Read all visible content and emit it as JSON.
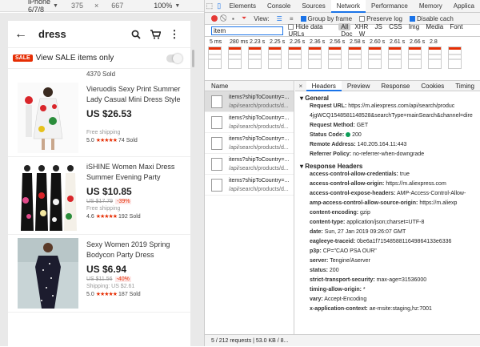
{
  "device_bar": {
    "device": "iPhone 6/7/8",
    "width": "375",
    "x": "×",
    "height": "667",
    "zoom": "100%",
    "more": "⋮"
  },
  "app": {
    "back": "←",
    "title": "dress",
    "search_icon": "⌕",
    "cart_icon": "🛒",
    "menu_icon": "⋮",
    "sale_badge": "SALE",
    "sale_text": "View SALE items only",
    "sold_top": "4370 Sold"
  },
  "products": [
    {
      "title": "Vieruodis Sexy Print Summer Lady Casual Mini Dress Style",
      "price": "US $26.53",
      "orig": "",
      "disc": "",
      "ship": "Free shipping",
      "rating": "5.0",
      "stars": "★★★★★",
      "sold": "74 Sold"
    },
    {
      "title": "iSHINE Women Maxi Dress Summer Evening Party Elegan...",
      "price": "US $10.85",
      "orig": "US $17.79",
      "disc": "-39%",
      "ship": "Free shipping",
      "rating": "4.6",
      "stars": "★★★★★",
      "sold": "192 Sold"
    },
    {
      "title": "Sexy Women 2019 Spring Bodycon Party Dress Elegant...",
      "price": "US $6.94",
      "orig": "US $11.56",
      "disc": "-40%",
      "ship": "Shipping: US $2.61",
      "rating": "5.0",
      "stars": "★★★★★",
      "sold": "187 Sold"
    }
  ],
  "devtools": {
    "tabs": [
      "Elements",
      "Console",
      "Sources",
      "Network",
      "Performance",
      "Memory",
      "Applica"
    ],
    "active_tab": "Network",
    "view_label": "View:",
    "group_by_frame": "Group by frame",
    "preserve_log": "Preserve log",
    "disable_cache": "Disable cach",
    "filter_value": "item",
    "hide_data_urls": "Hide data URLs",
    "filter_types": [
      "All",
      "XHR",
      "JS",
      "CSS",
      "Img",
      "Media",
      "Font",
      "Doc",
      "W"
    ],
    "timeline_labels": [
      "5 ms",
      "280 ms",
      "2.23 s",
      "2.25 s",
      "2.26 s",
      "2.36 s",
      "2.56 s",
      "2.58 s",
      "2.60 s",
      "2.61 s",
      "2.66 s",
      "2.8"
    ],
    "name_header": "Name",
    "requests": [
      {
        "line1": "items?shipToCountry=...",
        "line2": "/api/search/products/d..."
      },
      {
        "line1": "items?shipToCountry=...",
        "line2": "/api/search/products/d..."
      },
      {
        "line1": "items?shipToCountry=...",
        "line2": "/api/search/products/d..."
      },
      {
        "line1": "items?shipToCountry=...",
        "line2": "/api/search/products/d..."
      },
      {
        "line1": "items?shipToCountry=...",
        "line2": "/api/search/products/d..."
      }
    ],
    "detail_tabs": [
      "Headers",
      "Preview",
      "Response",
      "Cookies",
      "Timing"
    ],
    "general_title": "▾ General",
    "general": [
      {
        "k": "Request URL:",
        "v": "https://m.aliexpress.com/api/search/produc"
      },
      {
        "k": "",
        "v": "4jgWCQ1548581148528&searchType=mainSearch&channel=dire"
      },
      {
        "k": "Request Method:",
        "v": "GET"
      },
      {
        "k": "Status Code:",
        "v": "200"
      },
      {
        "k": "Remote Address:",
        "v": "140.205.164.11:443"
      },
      {
        "k": "Referrer Policy:",
        "v": "no-referrer-when-downgrade"
      }
    ],
    "response_title": "▾ Response Headers",
    "response_headers": [
      {
        "k": "access-control-allow-credentials:",
        "v": "true"
      },
      {
        "k": "access-control-allow-origin:",
        "v": "https://m.aliexpress.com"
      },
      {
        "k": "access-control-expose-headers:",
        "v": "AMP-Access-Control-Allow-"
      },
      {
        "k": "amp-access-control-allow-source-origin:",
        "v": "https://m.aliexp"
      },
      {
        "k": "content-encoding:",
        "v": "gzip"
      },
      {
        "k": "content-type:",
        "v": "application/json;charset=UTF-8"
      },
      {
        "k": "date:",
        "v": "Sun, 27 Jan 2019 09:26:07 GMT"
      },
      {
        "k": "eagleeye-traceid:",
        "v": "0be6a1f7154858811649864133e6336"
      },
      {
        "k": "p3p:",
        "v": "CP=\"CAO PSA OUR\""
      },
      {
        "k": "server:",
        "v": "Tengine/Aserver"
      },
      {
        "k": "status:",
        "v": "200"
      },
      {
        "k": "strict-transport-security:",
        "v": "max-age=31536000"
      },
      {
        "k": "timing-allow-origin:",
        "v": "*"
      },
      {
        "k": "vary:",
        "v": "Accept-Encoding"
      },
      {
        "k": "x-application-context:",
        "v": "ae-msite:staging,hz:7001"
      }
    ],
    "status_bar": "5 / 212 requests | 53.0 KB / 8..."
  }
}
